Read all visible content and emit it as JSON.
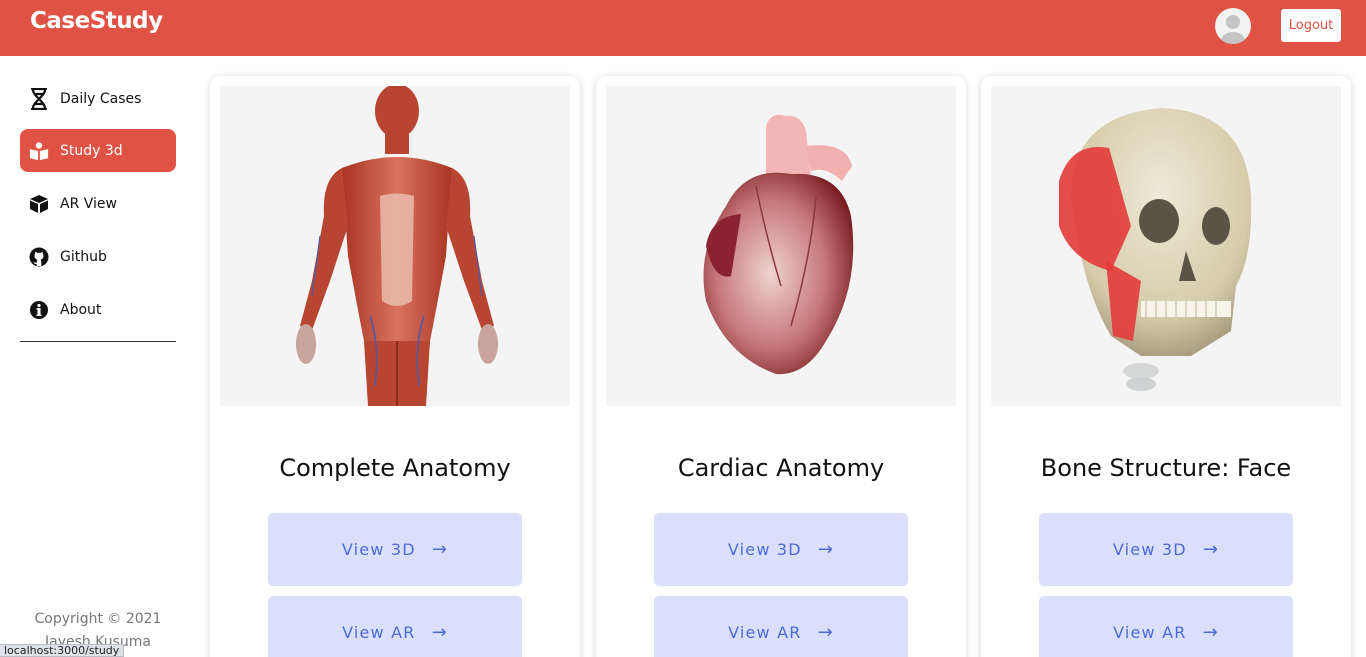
{
  "header": {
    "brand": "CaseStudy",
    "logout_label": "Logout",
    "accent_color": "#e05243"
  },
  "sidebar": {
    "items": [
      {
        "label": "Daily Cases",
        "icon": "dna-icon",
        "active": false
      },
      {
        "label": "Study 3d",
        "icon": "book-reader-icon",
        "active": true
      },
      {
        "label": "AR View",
        "icon": "cube-icon",
        "active": false
      },
      {
        "label": "Github",
        "icon": "github-icon",
        "active": false
      },
      {
        "label": "About",
        "icon": "info-icon",
        "active": false
      }
    ],
    "copyright_line1": "Copyright © 2021",
    "copyright_line2": "Jayesh Kusuma"
  },
  "cards": [
    {
      "title": "Complete Anatomy",
      "image": "muscular-body-image",
      "view3d_label": "View 3D",
      "viewar_label": "View AR",
      "arrow": "→"
    },
    {
      "title": "Cardiac Anatomy",
      "image": "heart-image",
      "view3d_label": "View 3D",
      "viewar_label": "View AR",
      "arrow": "→"
    },
    {
      "title": "Bone Structure: Face",
      "image": "skull-image",
      "view3d_label": "View 3D",
      "viewar_label": "View AR",
      "arrow": "→"
    }
  ],
  "status_bar": {
    "url": "localhost:3000/study"
  }
}
